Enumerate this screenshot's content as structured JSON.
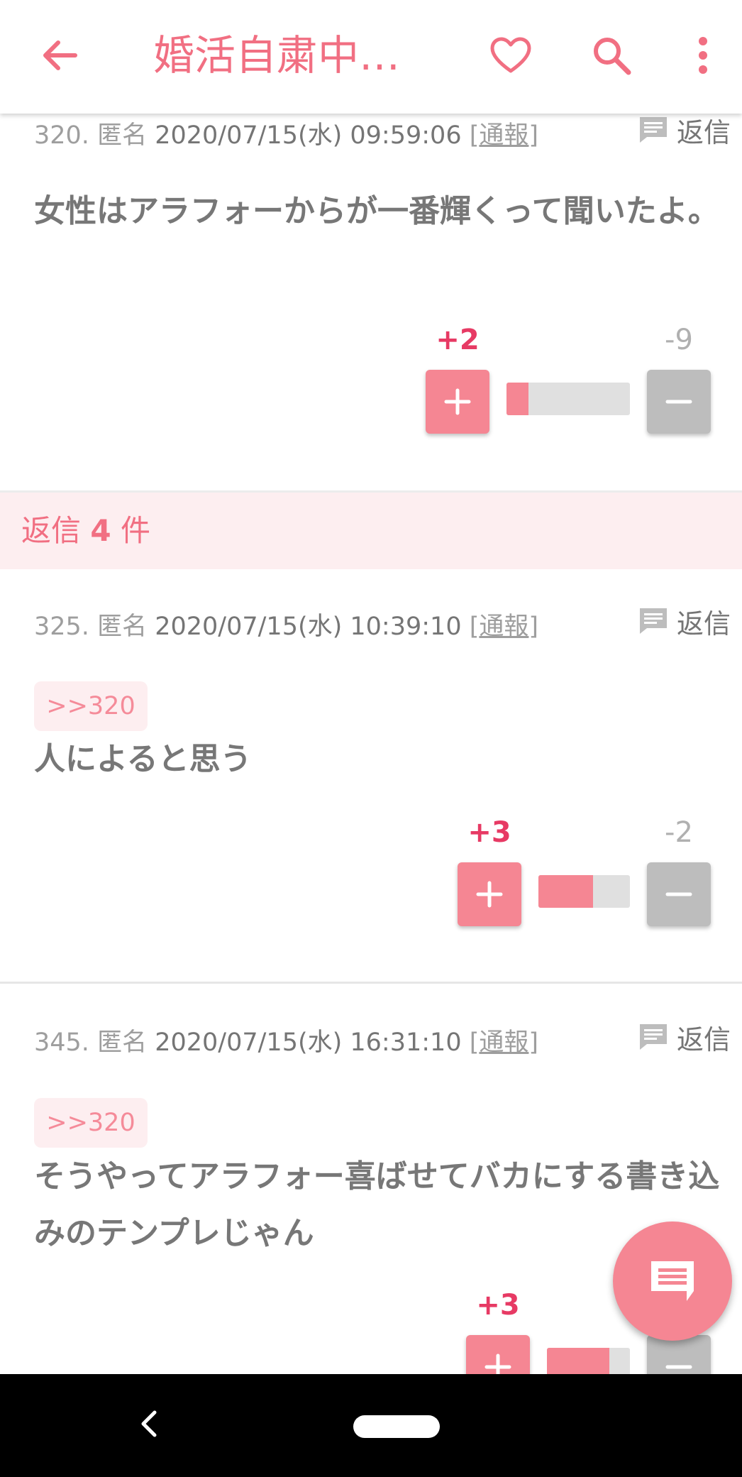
{
  "header": {
    "title": "婚活自粛中の…",
    "back_icon": "arrow-left-icon",
    "favorite_icon": "heart-outline-icon",
    "search_icon": "search-icon",
    "menu_icon": "more-vert-icon",
    "accent_color": "#f16f82"
  },
  "posts": [
    {
      "number": "320.",
      "author": "匿名",
      "datetime": "2020/07/15(水) 09:59:06",
      "report_open": "[",
      "report_label": "通報",
      "report_close": "]",
      "reply_label": "返信",
      "anchor": "",
      "text": "女性はアラフォーからが一番輝くって聞いたよ。",
      "plus": "+2",
      "minus": "-9",
      "plus_ratio": 0.18
    },
    {
      "number": "325.",
      "author": "匿名",
      "datetime": "2020/07/15(水) 10:39:10",
      "report_open": "[",
      "report_label": "通報",
      "report_close": "]",
      "reply_label": "返信",
      "anchor": ">>320",
      "text": "人によると思う",
      "plus": "+3",
      "minus": "-2",
      "plus_ratio": 0.6
    },
    {
      "number": "345.",
      "author": "匿名",
      "datetime": "2020/07/15(水) 16:31:10",
      "report_open": "[",
      "report_label": "通報",
      "report_close": "]",
      "reply_label": "返信",
      "anchor": ">>320",
      "text": "そうやってアラフォー喜ばせてバカにする書き込みのテンプレじゃん",
      "plus": "+3",
      "minus": "",
      "plus_ratio": 0.75
    }
  ],
  "reply_banner": {
    "prefix": "返信",
    "count": "4",
    "suffix": "件"
  },
  "fab": {
    "icon": "comment-icon"
  },
  "navbar": {
    "back_icon": "nav-back-icon",
    "home_icon": "nav-home-pill-icon"
  }
}
